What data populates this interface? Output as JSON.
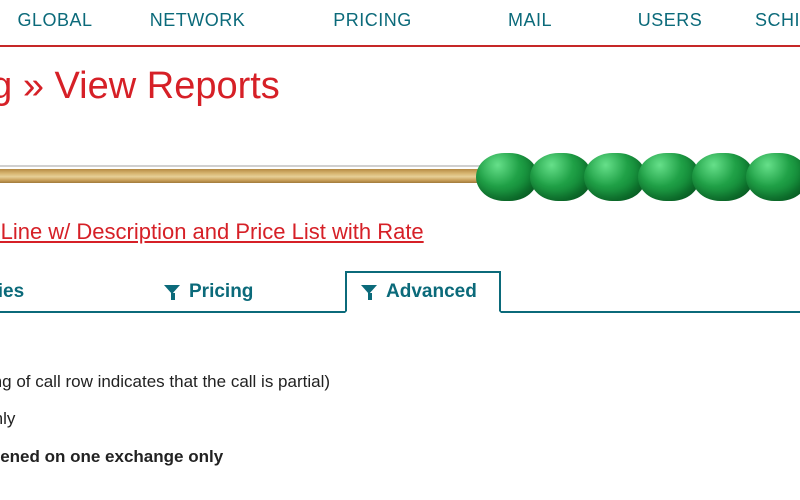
{
  "topnav": {
    "items": [
      "GLOBAL",
      "NETWORK",
      "PRICING",
      "MAIL",
      "USERS",
      "SCHI"
    ]
  },
  "page": {
    "title_fragment": "ng » View Reports"
  },
  "subheading": "ng Line w/ Description and Price List with Rate",
  "filter_tabs": {
    "items": [
      {
        "label": "rties",
        "active": false
      },
      {
        "label": "Pricing",
        "active": false
      },
      {
        "label": "Advanced",
        "active": true
      }
    ]
  },
  "notes": {
    "line1": "nning of call row indicates that the call is partial)",
    "line2": "e only",
    "line3": "appened on one exchange only"
  },
  "colors": {
    "brand_red": "#d62027",
    "teal": "#0b6a7a",
    "bead_green": "#20a147"
  }
}
